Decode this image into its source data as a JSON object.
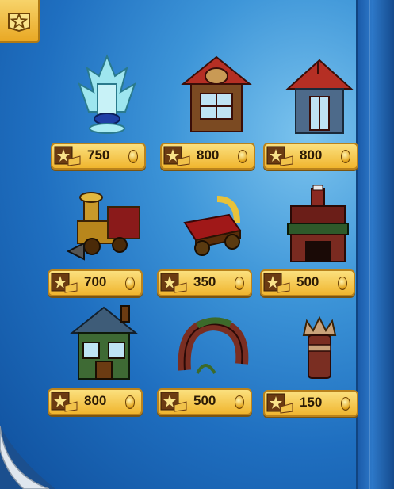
{
  "catalog": {
    "items": [
      {
        "name": "Ice Throne",
        "price": "750"
      },
      {
        "name": "Cottage",
        "price": "800"
      },
      {
        "name": "House",
        "price": "800"
      },
      {
        "name": "Train",
        "price": "700"
      },
      {
        "name": "Cart",
        "price": "350"
      },
      {
        "name": "Fireplace",
        "price": "500"
      },
      {
        "name": "Rustic House",
        "price": "800"
      },
      {
        "name": "Arch",
        "price": "500"
      },
      {
        "name": "Stump",
        "price": "150"
      }
    ]
  },
  "colors": {
    "accent": "#f0b52e",
    "background": "#1f6fc0"
  }
}
